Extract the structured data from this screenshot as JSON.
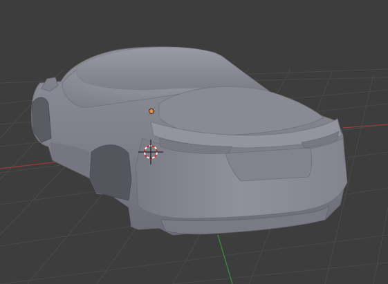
{
  "viewport": {
    "background_color": "#3d3d3d",
    "grid_color": "#4a4a4a",
    "x_axis_color": "#9a3a3a",
    "y_axis_color": "#3f8f3f",
    "car_body_color": "#8e8e99",
    "origin_color": "#e8923a",
    "cursor_ring_colors": [
      "#c33232",
      "#f2f2f2"
    ]
  },
  "icons": {
    "object_origin": "object-origin-icon",
    "cursor_3d": "3d-cursor-icon"
  }
}
